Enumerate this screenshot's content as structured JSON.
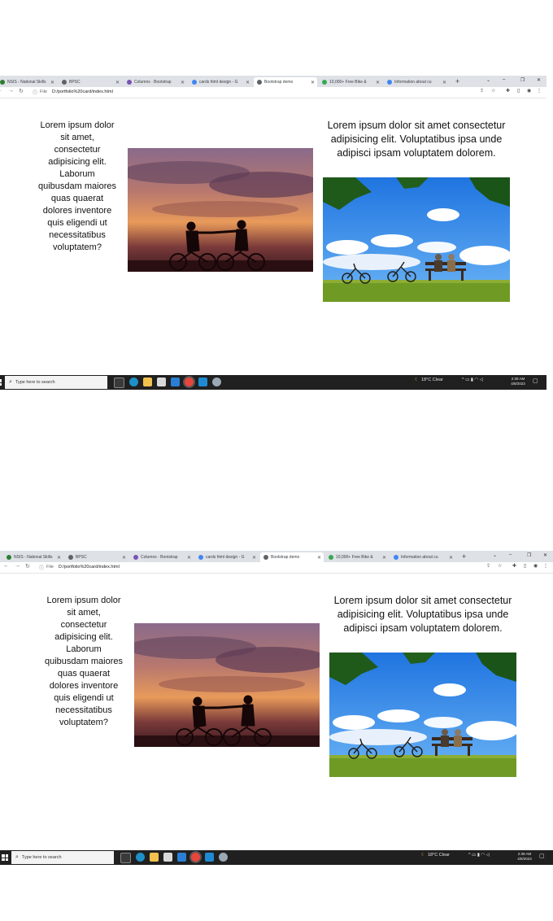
{
  "browser": {
    "tabs": [
      {
        "label": "NSIS - National Skills",
        "favicon_color": "#2e7d32",
        "active": false
      },
      {
        "label": "BPSC",
        "favicon_color": "#5f6368",
        "active": false
      },
      {
        "label": "Columns · Bootstrap",
        "favicon_color": "#7952b3",
        "active": false
      },
      {
        "label": "cards html design - G",
        "favicon_color": "#4285f4",
        "active": false
      },
      {
        "label": "Bootstrap demo",
        "favicon_color": "#5f6368",
        "active": true
      },
      {
        "label": "10,000+ Free Bike &",
        "favicon_color": "#36a853",
        "active": false
      },
      {
        "label": "Information about cu",
        "favicon_color": "#4285f4",
        "active": false
      }
    ],
    "new_tab": "+",
    "address_prefix": "File",
    "url": "D:/portfolio%20card/index.html"
  },
  "page": {
    "left_text": "Lorem ipsum dolor sit amet, consectetur adipisicing elit. Laborum quibusdam maiores quas quaerat dolores inventore quis eligendi ut necessitatibus voluptatem?",
    "right_text": "Lorem ipsum dolor sit amet consectetur adipisicing elit. Voluptatibus ipsa unde adipisci ipsam voluptatem dolorem.",
    "image_left": "sunset-cyclists-photo",
    "image_right": "bikes-bench-park-photo"
  },
  "taskbar": {
    "search_placeholder": "Type here to search",
    "weather": "18°C Clear",
    "time": "2:39 AM",
    "date": "4/8/2023"
  }
}
